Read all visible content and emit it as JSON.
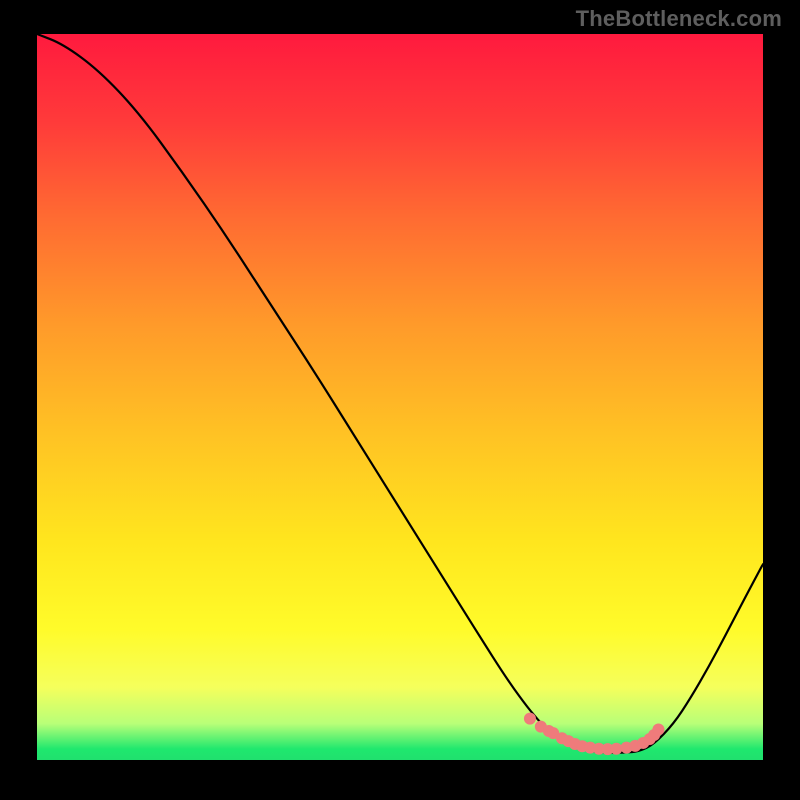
{
  "watermark": "TheBottleneck.com",
  "chart_data": {
    "type": "line",
    "title": "",
    "xlabel": "",
    "ylabel": "",
    "xlim": [
      0,
      100
    ],
    "ylim": [
      0,
      100
    ],
    "background_gradient": {
      "stops": [
        {
          "offset": 0.0,
          "color": "#ff1a3e"
        },
        {
          "offset": 0.12,
          "color": "#ff3a3a"
        },
        {
          "offset": 0.25,
          "color": "#ff6a32"
        },
        {
          "offset": 0.4,
          "color": "#ff9a2a"
        },
        {
          "offset": 0.55,
          "color": "#ffc224"
        },
        {
          "offset": 0.7,
          "color": "#ffe61e"
        },
        {
          "offset": 0.82,
          "color": "#fffb2a"
        },
        {
          "offset": 0.9,
          "color": "#f5ff5c"
        },
        {
          "offset": 0.95,
          "color": "#b8ff78"
        },
        {
          "offset": 0.985,
          "color": "#1fe86e"
        },
        {
          "offset": 1.0,
          "color": "#20e06e"
        }
      ]
    },
    "curve": {
      "x": [
        0.0,
        3.6,
        8.5,
        14.0,
        20.0,
        26.0,
        32.0,
        38.0,
        44.0,
        50.0,
        56.0,
        61.0,
        64.5,
        67.0,
        69.0,
        71.0,
        73.3,
        76.0,
        78.6,
        81.0,
        83.0,
        85.0,
        87.7,
        90.0,
        92.5,
        95.0,
        97.5,
        100.0
      ],
      "y": [
        100.0,
        98.6,
        95.0,
        89.2,
        81.0,
        72.3,
        63.0,
        53.8,
        44.2,
        34.6,
        25.0,
        17.0,
        11.5,
        8.0,
        5.5,
        3.5,
        2.0,
        1.2,
        1.0,
        1.0,
        1.2,
        2.2,
        5.0,
        8.5,
        12.8,
        17.5,
        22.3,
        27.0
      ]
    },
    "optimum_markers": {
      "x": [
        67.9,
        69.4,
        70.5,
        71.1,
        72.3,
        73.2,
        74.1,
        75.1,
        76.2,
        77.4,
        78.6,
        79.8,
        81.2,
        82.4,
        83.5,
        84.4,
        85.0,
        85.6
      ],
      "y": [
        5.7,
        4.6,
        4.0,
        3.7,
        3.0,
        2.6,
        2.2,
        1.9,
        1.7,
        1.55,
        1.5,
        1.55,
        1.7,
        1.95,
        2.35,
        2.9,
        3.45,
        4.2
      ],
      "color": "#ef7b7b",
      "radius_px": 6
    }
  }
}
